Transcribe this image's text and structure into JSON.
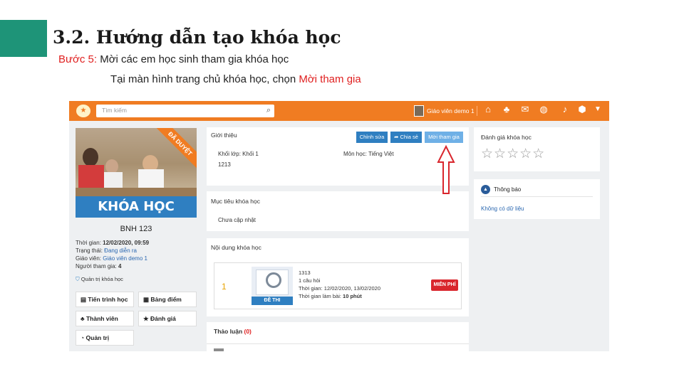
{
  "slide": {
    "title": "3.2. Hướng dẫn tạo khóa học",
    "step_label": "Bước 5:",
    "step_text": " Mời các em học sinh tham gia khóa học",
    "sub_text": "Tại màn hình trang chủ khóa học, chọn ",
    "sub_highlight": "Mời tham gia",
    "accent_color": "#1e9478",
    "highlight_color": "#e02020"
  },
  "app": {
    "search_placeholder": "Tìm kiếm",
    "user_name": "Giáo viên demo 1",
    "nav_icons": [
      "home-icon",
      "groups-icon",
      "chat-icon",
      "globe-icon",
      "bell-icon",
      "cube-icon",
      "caret-down-icon"
    ],
    "brand_color": "#f07c22",
    "course": {
      "ribbon": "ĐÃ DUYỆT",
      "banner": "KHÓA HỌC",
      "name": "BNH 123",
      "time_label": "Thời gian: ",
      "time_value": "12/02/2020, 09:59",
      "status_label": "Trạng thái: ",
      "status_value": "Đang diễn ra",
      "teacher_label": "Giáo viên: ",
      "teacher_value": "Giáo viên demo 1",
      "participants_label": "Người tham gia: ",
      "participants_value": "4",
      "manage_link": "Quản trị khóa học",
      "buttons": {
        "progress": "Tiến trình học",
        "gradebook": "Bảng điểm",
        "members": "Thành viên",
        "review": "Đánh giá",
        "admin": "Quản trị"
      }
    },
    "intro": {
      "title": "Giới thiệu",
      "edit_btn": "Chỉnh sửa",
      "share_btn": "Chia sẻ",
      "invite_btn": "Mời tham gia",
      "grade_label": "Khối lớp: ",
      "grade_value": "Khối 1",
      "subject_label": "Môn học: ",
      "subject_value": "Tiếng Việt",
      "code": "1213"
    },
    "goal": {
      "title": "Mục tiêu khóa học",
      "text": "Chưa cập nhật"
    },
    "content": {
      "title": "Nội dung khóa học",
      "lesson": {
        "index": "1",
        "thumb_label": "ĐỀ THI",
        "name": "1313",
        "questions": "1 câu hỏi",
        "time_label": "Thời gian: ",
        "time_value": "12/02/2020, 13/02/2020",
        "duration_label": "Thời gian làm bài: ",
        "duration_value": "10 phút",
        "free_badge": "MIỄN PHÍ"
      }
    },
    "discussion": {
      "title": "Thảo luận ",
      "count": "(0)"
    },
    "rating": {
      "title": "Đánh giá khóa học",
      "stars": "☆☆☆☆☆"
    },
    "notice": {
      "title": "Thông báo",
      "text": "Không có dữ liệu"
    }
  }
}
